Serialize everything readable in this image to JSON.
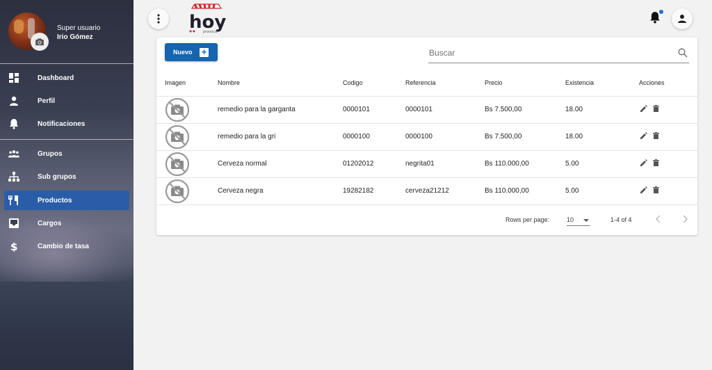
{
  "sidebar": {
    "user": {
      "role": "Super usuario",
      "name": "Irio Gómez"
    },
    "groups": [
      {
        "items": [
          {
            "id": "dashboard",
            "label": "Dashboard",
            "icon": "dashboard-icon",
            "active": false
          },
          {
            "id": "perfil",
            "label": "Perfil",
            "icon": "person-icon",
            "active": false
          },
          {
            "id": "notificaciones",
            "label": "Notificaciones",
            "icon": "bell-icon",
            "active": false
          }
        ]
      },
      {
        "items": [
          {
            "id": "grupos",
            "label": "Grupos",
            "icon": "people-icon",
            "active": false
          },
          {
            "id": "subgrupos",
            "label": "Sub grupos",
            "icon": "hierarchy-icon",
            "active": false
          },
          {
            "id": "productos",
            "label": "Productos",
            "icon": "utensils-icon",
            "active": true
          },
          {
            "id": "cargos",
            "label": "Cargos",
            "icon": "inbox-icon",
            "active": false
          },
          {
            "id": "cambio-tasa",
            "label": "Cambio de tasa",
            "icon": "dollar-icon",
            "active": false
          }
        ]
      }
    ]
  },
  "header": {
    "logo_text": "hoy",
    "logo_subtext": "provoca",
    "notification_badge": true
  },
  "toolbar": {
    "new_label": "Nuevo",
    "search_placeholder": "Buscar"
  },
  "table": {
    "columns": [
      "Imagen",
      "Nombre",
      "Codigo",
      "Referencia",
      "Precio",
      "Existencia",
      "Acciones"
    ],
    "rows": [
      {
        "nombre": "remedio para la garganta",
        "codigo": "0000101",
        "referencia": "0000101",
        "precio": "Bs 7.500,00",
        "existencia": "18.00"
      },
      {
        "nombre": "remedio para la gri",
        "codigo": "0000100",
        "referencia": "0000100",
        "precio": "Bs 7.500,00",
        "existencia": "18.00"
      },
      {
        "nombre": "Cerveza normal",
        "codigo": "01202012",
        "referencia": "negrita01",
        "precio": "Bs 110.000,00",
        "existencia": "5.00"
      },
      {
        "nombre": "Cerveza negra",
        "codigo": "19282182",
        "referencia": "cerveza21212",
        "precio": "Bs 110.000,00",
        "existencia": "5.00"
      }
    ]
  },
  "pagination": {
    "rows_per_page_label": "Rows per page:",
    "rows_per_page_value": "10",
    "range": "1-4 of 4"
  },
  "colors": {
    "accent": "#1565b0",
    "active_nav": "#2a5da8",
    "badge": "#1e6fd9",
    "logo_red": "#d8232a"
  }
}
